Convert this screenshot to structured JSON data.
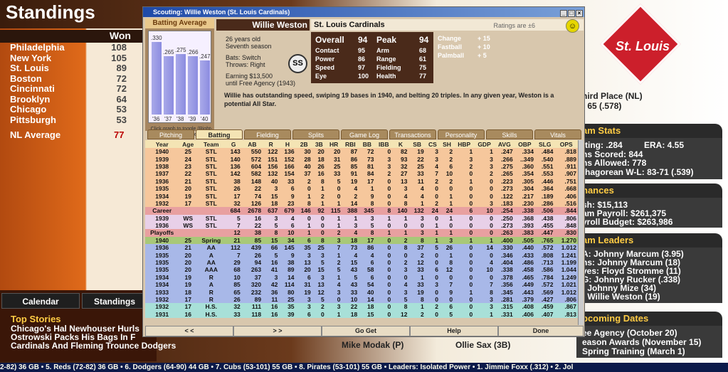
{
  "page": {
    "title": "Standings",
    "won_header": "Won",
    "teams": [
      {
        "name": "Philadelphia",
        "won": "108"
      },
      {
        "name": "New York",
        "won": "105"
      },
      {
        "name": "St. Louis",
        "won": "89"
      },
      {
        "name": "Boston",
        "won": "72"
      },
      {
        "name": "Cincinnati",
        "won": "72"
      },
      {
        "name": "Brooklyn",
        "won": "64"
      },
      {
        "name": "Chicago",
        "won": "53"
      },
      {
        "name": "Pittsburgh",
        "won": "53"
      }
    ],
    "nl_average_label": "NL Average",
    "nl_average": "77",
    "nav": {
      "calendar": "Calendar",
      "standings": "Standings"
    },
    "top_stories_title": "Top Stories",
    "stories": [
      "Chicago's Hal Newhouser Hurls",
      "Ostrowski Packs His Bags In F",
      "Cardinals And Fleming Trounce Dodgers"
    ],
    "footer_names": [
      "Mike Modak (P)",
      "Ollie Sax (3B)"
    ],
    "logo_text": "St. Louis",
    "right": {
      "place": "hird Place (NL)",
      "record": "- 65 (.578)",
      "team_stats_title": "am Stats",
      "team_stats": [
        "tting: .284",
        "ERA: 4.55",
        "ns Scored: 844",
        "ns Allowed: 778",
        "thagorean W-L: 83-71 (.539)"
      ],
      "finances_title": "nances",
      "finances": [
        "sh: $15,113",
        "am Payroll: $261,375",
        "yroll Budget: $263,986"
      ],
      "leaders_title": "am Leaders",
      "leaders": [
        "A: Johnny Marcum (3.95)",
        "ns: Johnny Marcum (18)",
        "ves: Floyd Stromme (11)",
        "G: Johnny Rucker (.338)",
        ": Johnny Mize (34)",
        ": Willie Weston (19)"
      ],
      "dates_title": "pcoming Dates",
      "dates": [
        "ee Agency (October 20)",
        "eason Awards (November 15)",
        "Spring Training (March 1)"
      ]
    },
    "ticker": "2-82) 36 GB  •  5. Reds (72-82) 36 GB  •  6. Dodgers (64-90) 44 GB  •  7. Cubs (53-101) 55 GB  •  8. Pirates (53-101) 55 GB  •  Leaders: Isolated Power  •  1. Jimmie Foxx (.312)  •  2. Jol"
  },
  "window": {
    "title": "Scouting: Willie Weston (St. Louis Cardinals)",
    "player_name": "Willie Weston",
    "team": "St. Louis Cardinals",
    "ratings_note": "Ratings are ±6",
    "batting_average_title": "Batting Average",
    "ba_chart": {
      "years": [
        "'36",
        "'37",
        "'38",
        "'39",
        "'40"
      ],
      "values": [
        0.33,
        0.265,
        0.275,
        0.266,
        0.247
      ],
      "labels": [
        ".330",
        ".265",
        ".275",
        ".266",
        ".247"
      ]
    },
    "toggle_hint": "Click graph to toggle (Right-click to choose)",
    "bio": {
      "age": "26 years old",
      "season": "Seventh season",
      "bats": "Bats: Switch",
      "throws": "Throws: Right",
      "earning": "Earning $13,500",
      "fa": "until Free Agency (1943)"
    },
    "position": "SS",
    "ratings": {
      "overall_label": "Overall",
      "overall": "94",
      "peak_label": "Peak",
      "peak": "94",
      "contact_label": "Contact",
      "contact": "95",
      "power_label": "Power",
      "power": "86",
      "speed_label": "Speed",
      "speed": "97",
      "eye_label": "Eye",
      "eye": "100",
      "arm_label": "Arm",
      "arm": "68",
      "range_label": "Range",
      "range": "61",
      "fielding_label": "Fielding",
      "fielding": "75",
      "health_label": "Health",
      "health": "77"
    },
    "potential": {
      "change_label": "Change",
      "change": "+ 15",
      "fastball_label": "Fastball",
      "fastball": "+ 10",
      "palmball_label": "Palmball",
      "palmball": "+ 5"
    },
    "description": "Willie has outstanding speed, swiping 19 bases in 1940, and belting 20 triples. In any given year, Weston is a potential All Star.",
    "tabs": [
      "Pitching",
      "Batting",
      "Fielding",
      "Splits",
      "Game Log",
      "Transactions",
      "Personality",
      "Skills",
      "Vitals"
    ],
    "active_tab": "Batting",
    "columns": [
      "Year",
      "Age",
      "Team",
      "G",
      "AB",
      "R",
      "H",
      "2B",
      "3B",
      "HR",
      "RBI",
      "BB",
      "IBB",
      "K",
      "SB",
      "CS",
      "SH",
      "HBP",
      "GDP",
      "AVG",
      "OBP",
      "SLG",
      "OPS"
    ],
    "rows": [
      {
        "bg": "#f6c79c",
        "cells": [
          "1940",
          "25",
          "STL",
          "143",
          "550",
          "122",
          "136",
          "30",
          "20",
          "20",
          "87",
          "72",
          "0",
          "82",
          "19",
          "3",
          "2",
          "1",
          "1",
          ".247",
          ".334",
          ".484",
          ".818"
        ]
      },
      {
        "bg": "#f6c79c",
        "cells": [
          "1939",
          "24",
          "STL",
          "140",
          "572",
          "151",
          "152",
          "28",
          "18",
          "31",
          "86",
          "73",
          "3",
          "93",
          "22",
          "3",
          "2",
          "3",
          "3",
          ".266",
          "..349",
          ".540",
          ".889"
        ]
      },
      {
        "bg": "#f6c79c",
        "cells": [
          "1938",
          "23",
          "STL",
          "136",
          "604",
          "156",
          "166",
          "40",
          "26",
          "25",
          "85",
          "81",
          "3",
          "32",
          "25",
          "4",
          "6",
          "2",
          "3",
          ".275",
          ".360",
          ".551",
          ".911"
        ]
      },
      {
        "bg": "#f6c79c",
        "cells": [
          "1937",
          "22",
          "STL",
          "142",
          "582",
          "132",
          "154",
          "37",
          "16",
          "33",
          "91",
          "84",
          "2",
          "27",
          "33",
          "7",
          "10",
          "0",
          "2",
          ".265",
          ".354",
          ".553",
          ".907"
        ]
      },
      {
        "bg": "#f6c79c",
        "cells": [
          "1936",
          "21",
          "STL",
          "38",
          "148",
          "40",
          "33",
          "2",
          "8",
          "5",
          "19",
          "17",
          "0",
          "13",
          "11",
          "2",
          "2",
          "1",
          "0",
          ".223",
          ".305",
          ".446",
          ".751"
        ]
      },
      {
        "bg": "#f6c79c",
        "cells": [
          "1935",
          "20",
          "STL",
          "26",
          "22",
          "3",
          "6",
          "0",
          "1",
          "0",
          "4",
          "1",
          "0",
          "3",
          "4",
          "0",
          "0",
          "0",
          "0",
          ".273",
          ".304",
          ".364",
          ".668"
        ]
      },
      {
        "bg": "#f6c79c",
        "cells": [
          "1934",
          "19",
          "STL",
          "17",
          "74",
          "15",
          "9",
          "1",
          "2",
          "0",
          "2",
          "9",
          "0",
          "4",
          "4",
          "0",
          "1",
          "0",
          "0",
          ".122",
          ".217",
          ".189",
          ".406"
        ]
      },
      {
        "bg": "#f6c79c",
        "cells": [
          "1932",
          "17",
          "STL",
          "32",
          "126",
          "18",
          "23",
          "8",
          "1",
          "1",
          "14",
          "8",
          "0",
          "8",
          "1",
          "2",
          "1",
          "0",
          "3",
          ".183",
          ".230",
          ".286",
          ".516"
        ]
      },
      {
        "bg": "#e8a0a0",
        "cells": [
          "Career",
          "",
          "",
          "684",
          "2678",
          "637",
          "679",
          "146",
          "92",
          "115",
          "388",
          "345",
          "8",
          "140",
          "132",
          "24",
          "24",
          "6",
          "10",
          ".254",
          ".338",
          ".506",
          ".844"
        ]
      },
      {
        "bg": "#e8d0e8",
        "cells": [
          "1939",
          "WS",
          "STL",
          "5",
          "16",
          "3",
          "4",
          "0",
          "0",
          "1",
          "1",
          "3",
          "1",
          "1",
          "3",
          "0",
          "1",
          "0",
          "0",
          ".250",
          ".368",
          ".438",
          ".806"
        ]
      },
      {
        "bg": "#e8d0e8",
        "cells": [
          "1936",
          "WS",
          "STL",
          "7",
          "22",
          "5",
          "6",
          "1",
          "0",
          "1",
          "3",
          "5",
          "0",
          "0",
          "0",
          "1",
          "0",
          "0",
          "0",
          ".273",
          ".393",
          ".455",
          ".848"
        ]
      },
      {
        "bg": "#e8a0a0",
        "cells": [
          "Playoffs",
          "",
          "",
          "12",
          "38",
          "8",
          "10",
          "1",
          "0",
          "2",
          "4",
          "8",
          "1",
          "1",
          "3",
          "1",
          "1",
          "0",
          "0",
          ".263",
          ".383",
          ".447",
          ".830"
        ]
      },
      {
        "bg": "#a8c878",
        "cells": [
          "1940",
          "25",
          "Spring",
          "21",
          "85",
          "15",
          "34",
          "6",
          "8",
          "3",
          "18",
          "17",
          "0",
          "2",
          "8",
          "1",
          "3",
          "1",
          "1",
          ".400",
          ".505",
          ".765",
          "1.270"
        ]
      },
      {
        "bg": "#a8b8e8",
        "cells": [
          "1936",
          "21",
          "AA",
          "112",
          "439",
          "66",
          "145",
          "35",
          "25",
          "7",
          "73",
          "86",
          "0",
          "8",
          "37",
          "5",
          "26",
          "0",
          "14",
          ".330",
          ".440",
          ".572",
          "1.012"
        ]
      },
      {
        "bg": "#a8b8e8",
        "cells": [
          "1935",
          "20",
          "A",
          "7",
          "26",
          "5",
          "9",
          "3",
          "3",
          "1",
          "4",
          "4",
          "0",
          "0",
          "2",
          "0",
          "1",
          "0",
          "0",
          ".346",
          ".433",
          ".808",
          "1.241"
        ]
      },
      {
        "bg": "#a8b8e8",
        "cells": [
          "1935",
          "20",
          "AA",
          "29",
          "94",
          "16",
          "38",
          "13",
          "5",
          "2",
          "15",
          "6",
          "0",
          "2",
          "12",
          "0",
          "8",
          "0",
          "4",
          ".404",
          ".486",
          ".713",
          "1.199"
        ]
      },
      {
        "bg": "#a8b8e8",
        "cells": [
          "1935",
          "20",
          "AAA",
          "68",
          "263",
          "41",
          "89",
          "20",
          "15",
          "5",
          "43",
          "58",
          "0",
          "3",
          "33",
          "6",
          "12",
          "0",
          "10",
          ".338",
          ".458",
          ".586",
          "1.044"
        ]
      },
      {
        "bg": "#a8b8e8",
        "cells": [
          "1934",
          "19",
          "R",
          "10",
          "37",
          "3",
          "14",
          "6",
          "3",
          "1",
          "5",
          "6",
          "0",
          "0",
          "1",
          "0",
          "0",
          "0",
          "0",
          ".378",
          ".465",
          ".784",
          "1.249"
        ]
      },
      {
        "bg": "#a8b8e8",
        "cells": [
          "1934",
          "19",
          "A",
          "85",
          "320",
          "42",
          "114",
          "31",
          "13",
          "4",
          "43",
          "54",
          "0",
          "4",
          "33",
          "3",
          "7",
          "0",
          "7",
          ".356",
          ".449",
          ".572",
          "1.021"
        ]
      },
      {
        "bg": "#a8b8e8",
        "cells": [
          "1933",
          "18",
          "R",
          "65",
          "232",
          "36",
          "80",
          "19",
          "12",
          "3",
          "33",
          "40",
          "0",
          "3",
          "19",
          "0",
          "9",
          "1",
          "8",
          ".345",
          ".443",
          ".569",
          "1.012"
        ]
      },
      {
        "bg": "#a8b8e8",
        "cells": [
          "1932",
          "17",
          "R",
          "26",
          "89",
          "11",
          "25",
          "3",
          "5",
          "0",
          "10",
          "14",
          "0",
          "5",
          "8",
          "0",
          "0",
          "0",
          "3",
          ".281",
          ".379",
          ".427",
          ".806"
        ]
      },
      {
        "bg": "#a8e0d8",
        "cells": [
          "1932",
          "17",
          "H.S.",
          "32",
          "111",
          "16",
          "35",
          "3",
          "2",
          "3",
          "22",
          "18",
          "0",
          "8",
          "1",
          "2",
          "6",
          "0",
          "3",
          ".315",
          ".408",
          ".459",
          ".867"
        ]
      },
      {
        "bg": "#a8e0d8",
        "cells": [
          "1931",
          "16",
          "H.S.",
          "33",
          "118",
          "16",
          "39",
          "6",
          "0",
          "1",
          "18",
          "15",
          "0",
          "12",
          "2",
          "0",
          "5",
          "0",
          "1",
          ".331",
          ".406",
          ".407",
          ".813"
        ]
      }
    ],
    "buttons": {
      "prev": "< <",
      "next": "> >",
      "go_get": "Go Get",
      "help": "Help",
      "done": "Done"
    }
  }
}
